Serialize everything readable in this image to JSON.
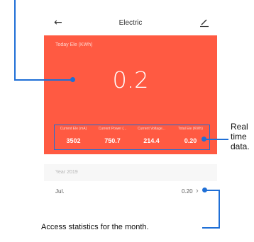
{
  "header": {
    "title": "Electric",
    "back_icon": "back-arrow-icon",
    "edit_icon": "edit-icon"
  },
  "hero": {
    "label": "Today Ele (KWh)",
    "value": "0.2",
    "color": "#ff5a42"
  },
  "stats": [
    {
      "label": "Current Ele (mA)",
      "value": "3502"
    },
    {
      "label": "Current Power (...",
      "value": "750.7"
    },
    {
      "label": "Current Voltage...",
      "value": "214.4"
    },
    {
      "label": "Total Ele (KWh)",
      "value": "0.20"
    }
  ],
  "history": {
    "year_label": "Year 2019",
    "rows": [
      {
        "month": "Jul.",
        "value": "0.20"
      }
    ]
  },
  "annotations": {
    "realtime_label": [
      "Real",
      "time",
      "data."
    ],
    "monthly_label": "Access statistics for the month.",
    "callout_color": "#1f6fd6"
  }
}
